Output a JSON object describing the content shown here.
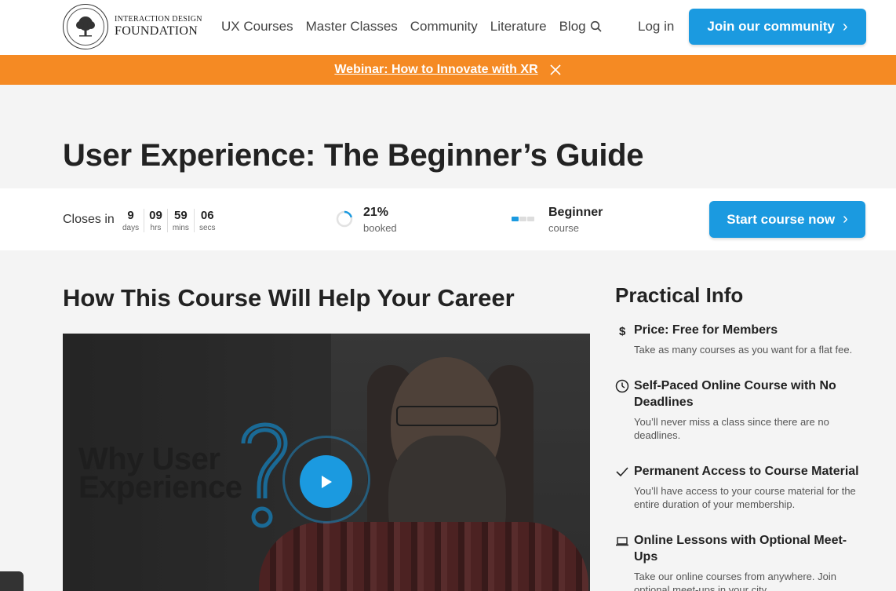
{
  "header": {
    "logo_line1": "INTERACTION DESIGN",
    "logo_line2": "FOUNDATION",
    "nav": [
      "UX Courses",
      "Master Classes",
      "Community",
      "Literature",
      "Blog"
    ],
    "login_label": "Log in",
    "join_label": "Join our community"
  },
  "banner": {
    "link_text": "Webinar: How to Innovate with XR"
  },
  "page_title": "User Experience: The Beginner’s Guide",
  "stats": {
    "closes_label": "Closes in",
    "countdown": [
      {
        "value": "9",
        "unit": "days"
      },
      {
        "value": "09",
        "unit": "hrs"
      },
      {
        "value": "59",
        "unit": "mins"
      },
      {
        "value": "06",
        "unit": "secs"
      }
    ],
    "booked_value": "21%",
    "booked_fraction": 0.21,
    "booked_label": "booked",
    "level_value": "Beginner",
    "level_label": "course",
    "level_step": 1,
    "level_steps_total": 3,
    "start_label": "Start course now"
  },
  "main": {
    "section_title": "How This Course Will Help Your Career",
    "video_caption_line1": "Why User",
    "video_caption_line2": "Experience"
  },
  "sidebar": {
    "title": "Practical Info",
    "items": [
      {
        "icon": "dollar-icon",
        "title": "Price: Free for Members",
        "body": "Take as many courses as you want for a flat fee."
      },
      {
        "icon": "clock-icon",
        "title": "Self-Paced Online Course with No Deadlines",
        "body": "You’ll never miss a class since there are no deadlines."
      },
      {
        "icon": "checkmark-icon",
        "title": "Permanent Access to Course Material",
        "body": "You’ll have access to your course material for the entire duration of your membership."
      },
      {
        "icon": "laptop-icon",
        "title": "Online Lessons with Optional Meet-Ups",
        "body": "Take our online courses from anywhere. Join optional meet-ups in your city."
      }
    ]
  },
  "colors": {
    "accent_blue": "#1b9ae0",
    "banner_orange": "#f58a23"
  }
}
